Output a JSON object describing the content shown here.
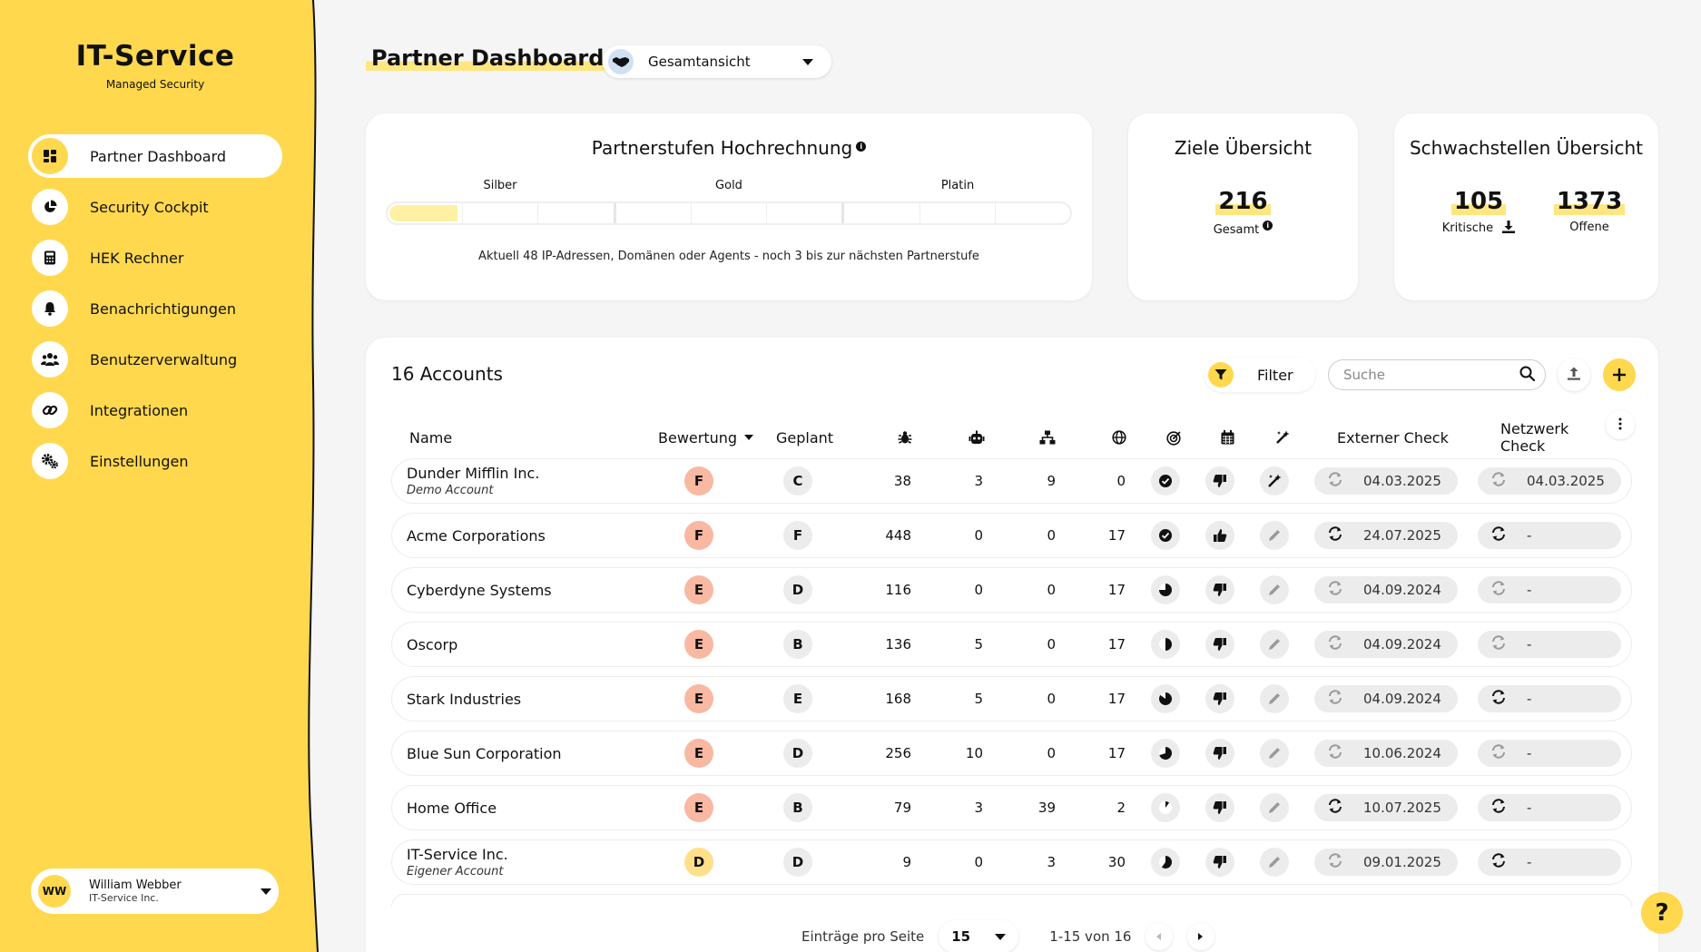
{
  "colors": {
    "accent": "#ffd84e",
    "highlight": "#ffe680",
    "grade_f": "#f9b8a2",
    "grade_e": "#f9b8a2",
    "grade_d": "#ffe08a",
    "grade_neutral": "#ececec"
  },
  "brand": {
    "title": "IT-Service",
    "subtitle": "Managed Security"
  },
  "nav": {
    "items": [
      {
        "label": "Partner Dashboard",
        "icon": "dashboard-icon",
        "active": true
      },
      {
        "label": "Security Cockpit",
        "icon": "pie-chart-icon"
      },
      {
        "label": "HEK Rechner",
        "icon": "calculator-icon"
      },
      {
        "label": "Benachrichtigungen",
        "icon": "bell-icon"
      },
      {
        "label": "Benutzerverwaltung",
        "icon": "users-icon"
      },
      {
        "label": "Integrationen",
        "icon": "link-icon"
      },
      {
        "label": "Einstellungen",
        "icon": "gears-icon"
      }
    ]
  },
  "user": {
    "initials": "WW",
    "name": "William Webber",
    "org": "IT-Service Inc."
  },
  "header": {
    "title": "Partner Dashboard",
    "view": "Gesamtansicht"
  },
  "tier": {
    "title": "Partnerstufen Hochrechnung",
    "levels": [
      "Silber",
      "Gold",
      "Platin"
    ],
    "progress_fraction": 0.1,
    "note": "Aktuell 48 IP-Adressen, Domänen oder Agents - noch 3 bis zur nächsten Partnerstufe"
  },
  "goals": {
    "title": "Ziele Übersicht",
    "total": "216",
    "total_label": "Gesamt"
  },
  "vuln": {
    "title": "Schwachstellen Übersicht",
    "critical": "105",
    "critical_label": "Kritische",
    "open": "1373",
    "open_label": "Offene"
  },
  "accounts": {
    "heading": "16 Accounts",
    "filter_label": "Filter",
    "search_placeholder": "Suche",
    "columns": {
      "name": "Name",
      "rating": "Bewertung",
      "planned": "Geplant",
      "external": "Externer Check",
      "network": "Netzwerk Check"
    },
    "column_icons": [
      "bug-icon",
      "robot-icon",
      "network-icon",
      "globe-icon",
      "target-icon",
      "calendar-icon",
      "magic-wand-icon"
    ],
    "rows": [
      {
        "name": "Dunder Mifflin Inc.",
        "sub": "Demo Account",
        "rating": "F",
        "planned": "C",
        "bugs": "38",
        "agents": "3",
        "networks": "9",
        "domains": "0",
        "progress": "check",
        "vote": "down",
        "wand": "wand",
        "ext": "04.03.2025",
        "net": "04.03.2025",
        "ext_active": false,
        "net_active": false
      },
      {
        "name": "Acme Corporations",
        "sub": "",
        "rating": "F",
        "planned": "F",
        "bugs": "448",
        "agents": "0",
        "networks": "0",
        "domains": "17",
        "progress": "check",
        "vote": "up",
        "wand": "pencil",
        "ext": "24.07.2025",
        "net": "-",
        "ext_active": true,
        "net_active": true
      },
      {
        "name": "Cyberdyne Systems",
        "sub": "",
        "rating": "E",
        "planned": "D",
        "bugs": "116",
        "agents": "0",
        "networks": "0",
        "domains": "17",
        "progress": "0.75",
        "vote": "down",
        "wand": "pencil",
        "ext": "04.09.2024",
        "net": "-",
        "ext_active": false,
        "net_active": false
      },
      {
        "name": "Oscorp",
        "sub": "",
        "rating": "E",
        "planned": "B",
        "bugs": "136",
        "agents": "5",
        "networks": "0",
        "domains": "17",
        "progress": "0.5",
        "vote": "down",
        "wand": "pencil",
        "ext": "04.09.2024",
        "net": "-",
        "ext_active": false,
        "net_active": false
      },
      {
        "name": "Stark Industries",
        "sub": "",
        "rating": "E",
        "planned": "E",
        "bugs": "168",
        "agents": "5",
        "networks": "0",
        "domains": "17",
        "progress": "0.85",
        "vote": "down",
        "wand": "pencil",
        "ext": "04.09.2024",
        "net": "-",
        "ext_active": false,
        "net_active": true
      },
      {
        "name": "Blue Sun Corporation",
        "sub": "",
        "rating": "E",
        "planned": "D",
        "bugs": "256",
        "agents": "10",
        "networks": "0",
        "domains": "17",
        "progress": "0.7",
        "vote": "down",
        "wand": "pencil",
        "ext": "10.06.2024",
        "net": "-",
        "ext_active": false,
        "net_active": false
      },
      {
        "name": "Home Office",
        "sub": "",
        "rating": "E",
        "planned": "B",
        "bugs": "79",
        "agents": "3",
        "networks": "39",
        "domains": "2",
        "progress": "0.1",
        "vote": "down",
        "wand": "pencil",
        "ext": "10.07.2025",
        "net": "-",
        "ext_active": true,
        "net_active": true
      },
      {
        "name": "IT-Service Inc.",
        "sub": "Eigener Account",
        "rating": "D",
        "planned": "D",
        "bugs": "9",
        "agents": "0",
        "networks": "3",
        "domains": "30",
        "progress": "0.6",
        "vote": "down",
        "wand": "pencil",
        "ext": "09.01.2025",
        "net": "-",
        "ext_active": false,
        "net_active": true
      }
    ]
  },
  "pager": {
    "label": "Einträge pro Seite",
    "per_page": "15",
    "range": "1-15 von 16"
  },
  "help": "?"
}
